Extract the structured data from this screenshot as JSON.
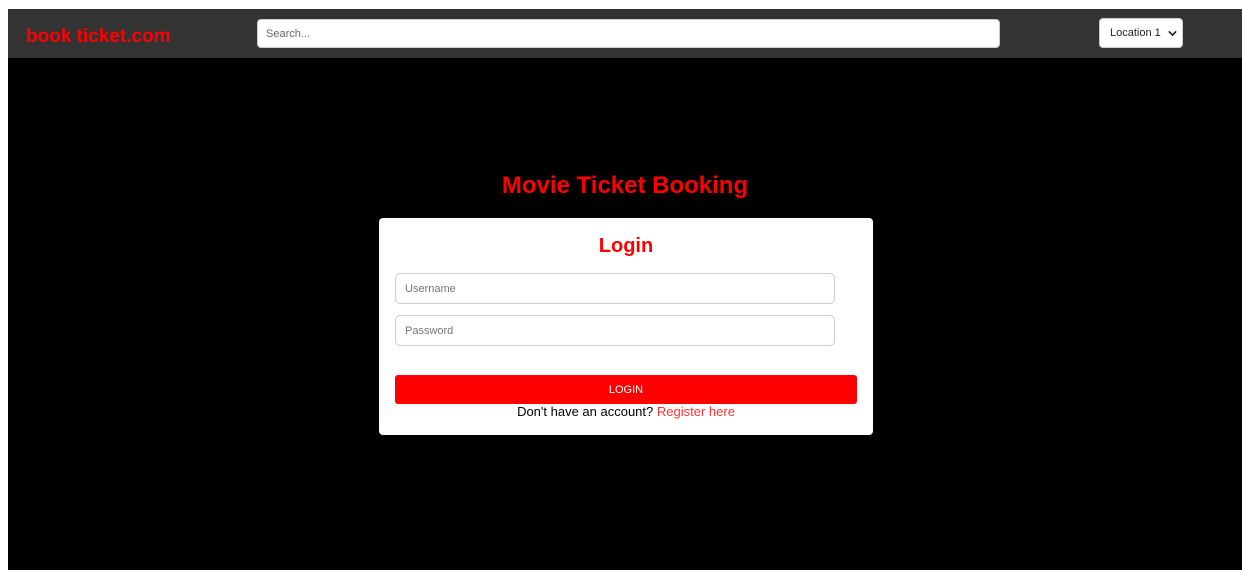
{
  "colors": {
    "accent": "#ff0000",
    "link": "#ff3333",
    "navbar_bg": "#333333",
    "page_bg": "#000000"
  },
  "navbar": {
    "brand": "book ticket.com",
    "search_placeholder": "Search...",
    "location_selected": "Location 1",
    "location_icon": "chevron-down-icon"
  },
  "main": {
    "title": "Movie Ticket Booking"
  },
  "login_form": {
    "heading": "Login",
    "username_placeholder": "Username",
    "password_placeholder": "Password",
    "submit_label": "LOGIN",
    "register_prompt": "Don't have an account?",
    "register_link": "Register here"
  }
}
